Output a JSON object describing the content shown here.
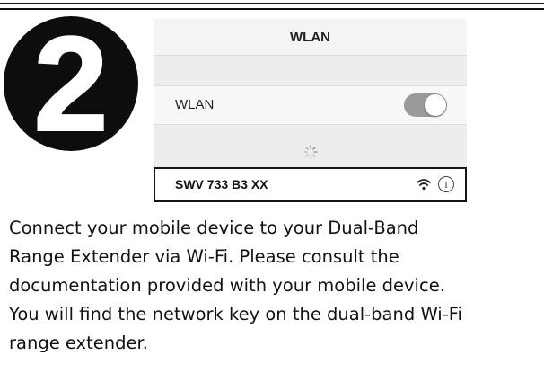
{
  "step": {
    "number": "2"
  },
  "phone": {
    "nav_title": "WLAN",
    "wlan_toggle": {
      "label": "WLAN",
      "on": true
    },
    "network": {
      "name": "SWV 733 B3 XX",
      "wifi_icon": "wifi-icon",
      "info_icon": "info-icon",
      "info_glyph": "i"
    }
  },
  "instructions": {
    "lines": [
      "Connect your mobile device to your Dual-Band",
      "Range Extender via Wi-Fi. Please consult the",
      "documentation provided with your mobile device.",
      "You will find the network key on the dual-band Wi-Fi",
      "range extender."
    ]
  }
}
